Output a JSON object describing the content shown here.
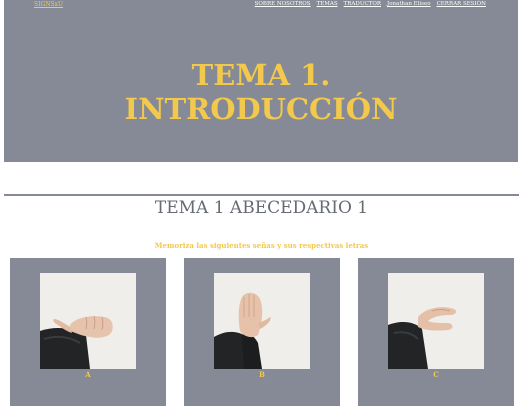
{
  "navbar": {
    "brand": "SIGNSxU",
    "links": [
      "SOBRE NOSOTROS",
      "TEMAS",
      "TRADUCTOR",
      "Jonathan Eliseo",
      "CERRAR SESIÓN"
    ]
  },
  "hero": {
    "title_line1": "TEMA 1.",
    "title_line2": "INTRODUCCIÓN"
  },
  "section": {
    "title": "TEMA 1 ABECEDARIO 1",
    "instruction": "Memoriza las siguientes señas y sus respectivas letras"
  },
  "cards": [
    {
      "letter": "A",
      "icon": "hand-sign-a-photo"
    },
    {
      "letter": "B",
      "icon": "hand-sign-b-photo"
    },
    {
      "letter": "C",
      "icon": "hand-sign-c-photo"
    }
  ],
  "colors": {
    "panel": "#858a96",
    "accent": "#f2c94c",
    "section_title": "#666a73"
  }
}
